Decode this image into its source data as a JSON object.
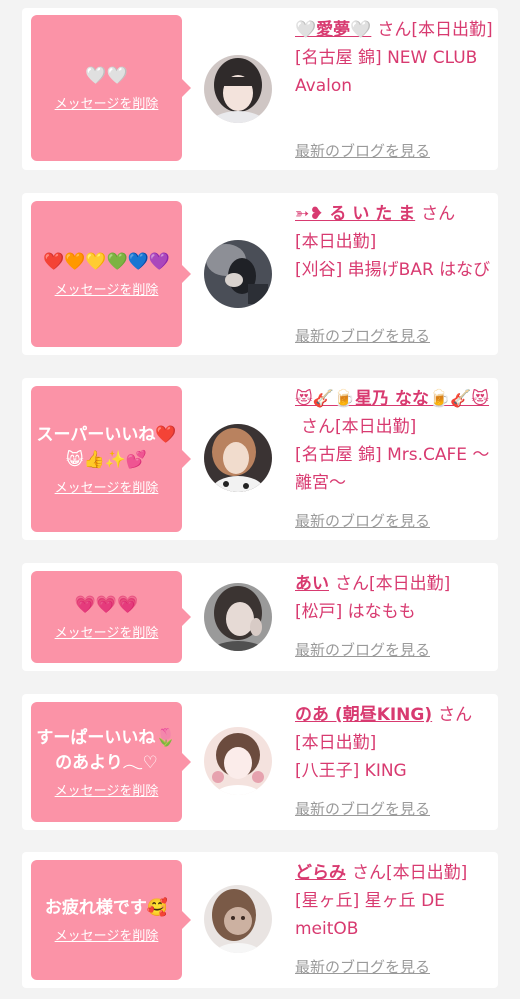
{
  "colors": {
    "bubble": "#fb93a7",
    "accent": "#d83a70",
    "muted": "#9a9a9a",
    "background": "#f3f3f3"
  },
  "messages": [
    {
      "message": "🤍🤍",
      "delete_label": "メッセージを削除",
      "name": "🤍愛夢🤍",
      "san": "さん",
      "status": "[本日出勤]",
      "store": "[名古屋 錦] NEW CLUB Avalon",
      "blog_link": "最新のブログを見る",
      "avatar_icon": "profile-photo"
    },
    {
      "message": "❤️🧡💛💚💙💜",
      "delete_label": "メッセージを削除",
      "name": "➳❥ る い た ま",
      "san": "さん",
      "status": "[本日出勤]",
      "store": "[刈谷] 串揚げBAR はなび",
      "blog_link": "最新のブログを見る",
      "avatar_icon": "profile-photo"
    },
    {
      "message": "スーパーいいね❤️\n😸👍✨💕",
      "delete_label": "メッセージを削除",
      "name": "😻🎸🍺星乃 なな🍺🎸😻",
      "san": "さん",
      "status": "[本日出勤]",
      "store": "[名古屋 錦] Mrs.CAFE 〜離宮〜",
      "blog_link": "最新のブログを見る",
      "avatar_icon": "profile-photo"
    },
    {
      "message": "💗💗💗",
      "delete_label": "メッセージを削除",
      "name": "あい",
      "san": "さん",
      "status": "[本日出勤]",
      "store": "[松戸] はなもも",
      "blog_link": "最新のブログを見る",
      "avatar_icon": "profile-photo"
    },
    {
      "message": "すーぱーいいね🌷\nのあより𓂃♡",
      "delete_label": "メッセージを削除",
      "name": "のあ (朝昼KING)",
      "san": "さん",
      "status": "[本日出勤]",
      "store": "[八王子] KING",
      "blog_link": "最新のブログを見る",
      "avatar_icon": "profile-photo"
    },
    {
      "message": "お疲れ様です🥰",
      "delete_label": "メッセージを削除",
      "name": "どらみ",
      "san": "さん",
      "status": "[本日出勤]",
      "store": "[星ヶ丘] 星ヶ丘 DE meitOB",
      "blog_link": "最新のブログを見る",
      "avatar_icon": "profile-photo"
    }
  ]
}
